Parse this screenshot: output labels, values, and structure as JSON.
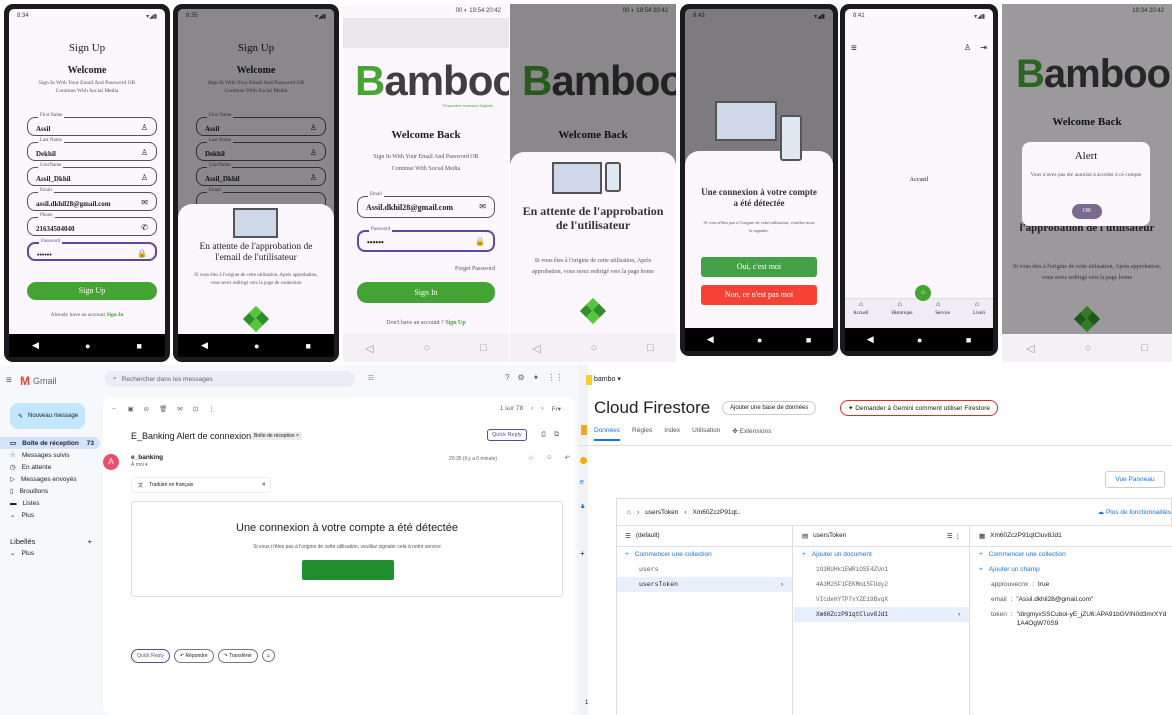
{
  "signup": {
    "time": "8:34",
    "title": "Sign Up",
    "welcome": "Welcome",
    "subtitle": "Sign In With Your Email And Password OR Continue With Social Media",
    "fields": [
      {
        "label": "First Name",
        "value": "Assil",
        "icon": "person-icon"
      },
      {
        "label": "Last Name",
        "value": "Dekhil",
        "icon": "person-icon"
      },
      {
        "label": "UserName",
        "value": "Assil_Dkhil",
        "icon": "person-icon"
      },
      {
        "label": "Email",
        "value": "assil.dkhil28@gmail.com",
        "icon": "mail-icon"
      },
      {
        "label": "Phone",
        "value": "21634504040",
        "icon": "phone-icon"
      },
      {
        "label": "Password",
        "value": "••••••",
        "icon": "lock-icon"
      }
    ],
    "button": "Sign Up",
    "footer_text": "Already have an account",
    "footer_link": "Sign In"
  },
  "signup_wait": {
    "time": "8:35",
    "title": "Sign Up",
    "welcome": "Welcome",
    "subtitle": "Sign In With Your Email And Password OR Continue With Social Media",
    "fields": [
      {
        "label": "First Name",
        "value": "Assil"
      },
      {
        "label": "Last Name",
        "value": "Dekhil"
      },
      {
        "label": "UserName",
        "value": "Assil_Dkhil"
      },
      {
        "label": "Email",
        "value": ""
      }
    ],
    "sheet_title": "En attente de l'approbation de l'email de l'utilisateur",
    "sheet_text": "Si vous êtes à l'origine de cette utilisation, Après approbation, vous serez redirigé vers la page de connexion"
  },
  "signin": {
    "status": "00 ◐ 19:54 20:42",
    "logo_a": "B",
    "logo_b": "amboo",
    "tagline": "Financière Inclusive Digitale",
    "welcome": "Welcome Back",
    "subtitle": "Sign In With Your Email And Password OR Continue With Social Media",
    "email_label": "Email",
    "email_value": "Assil.dkhil28@gmail.com",
    "password_label": "Password",
    "password_value": "••••••",
    "forget": "Forget Password",
    "button": "Sign In",
    "footer_text": "Don't have an account ?",
    "footer_link": "Sign Up"
  },
  "signin_wait": {
    "status": "00 ◐ 19:54 20:42",
    "logo_b": "amboo",
    "welcome": "Welcome Back",
    "sheet_title": "En attente de l'approbation de l'utilisateur",
    "sheet_text": "Si vous êtes à l'origine de cette utilisation, Après approbation, vous serez redirigé vers la page home"
  },
  "detect": {
    "time": "8:43",
    "title": "Une connexion à votre compte a été détectée",
    "text": "Si vous n'êtes pas à l'origine de cette utilisation, veuillez nous le signaler.",
    "yes": "Oui, c'est moi",
    "no": "Non, ce n'est pas moi"
  },
  "home": {
    "time": "8:41",
    "center": "Accueil",
    "tabs": [
      "Accueil",
      "Historique",
      "Service",
      "Lixeli"
    ]
  },
  "alert": {
    "status": "19:34 20:42",
    "logo_b": "amboo",
    "welcome": "Welcome Back",
    "title": "Alert",
    "message": "Vous n'avez pas été autorisé à accéder à ce compte",
    "ok": "OK",
    "bg_title": "l'approbation de l'utilisateur",
    "bg_text": "Si vous êtes à l'origine de cette utilisation, Après approbation, vous serez redirigé vers la page home"
  },
  "gmail": {
    "app": "Gmail",
    "search": "Rechercher dans les messages",
    "compose": "Nouveau message",
    "nav": [
      {
        "icon": "inbox-icon",
        "label": "Boîte de réception",
        "count": "73"
      },
      {
        "icon": "star-icon",
        "label": "Messages suivis",
        "count": ""
      },
      {
        "icon": "clock-icon",
        "label": "En attente",
        "count": ""
      },
      {
        "icon": "send-icon",
        "label": "Messages envoyés",
        "count": ""
      },
      {
        "icon": "file-icon",
        "label": "Brouillons",
        "count": ""
      },
      {
        "icon": "list-icon",
        "label": "Listes",
        "count": ""
      },
      {
        "icon": "chevron-down-icon",
        "label": "Plus",
        "count": ""
      }
    ],
    "labels_title": "Libellés",
    "labels_more": "Plus",
    "pager": "1 sur 78",
    "subject": "E_Banking Alert de connexion",
    "inbox_tag": "Boîte de réception ×",
    "quick_reply": "Quick Reply",
    "sender": "e_banking",
    "to": "À moi ▾",
    "date": "20:35 (il y a 0 minute)",
    "translate": "Traduire en français",
    "mail_title": "Une connexion à votre compte a été détectée",
    "mail_text": "Si vous n'êtes pas à l'origine de cette utilisation, veuillez signaler cela à notre service",
    "reply": "Répondre",
    "forward": "Transférer"
  },
  "firestore": {
    "project": "bambo",
    "title": "Cloud Firestore",
    "add_db": "Ajouter une base de données",
    "gemini": "Demander à Gemini comment utiliser Firestore",
    "tabs": [
      "Données",
      "Règles",
      "Index",
      "Utilisation",
      "Extensions"
    ],
    "panel_view": "Vue Panneau",
    "breadcrumb": [
      "usersToken",
      "Xm60ZczP91qt.."
    ],
    "more": "Plus de fonctionnalités",
    "col1_title": "(default)",
    "col1_action": "Commencer une collection",
    "col1_items": [
      "users",
      "usersToken"
    ],
    "col2_title": "usersToken",
    "col2_action": "Ajouter un document",
    "col2_items": [
      "1O3RUHk1EWRiOSE4ZUo1",
      "4A3M2SF1FEKMm15FUdy2",
      "VIcdeHYTP7xYZE19BvqX",
      "Xm60ZczP91qtCluv8Jd1"
    ],
    "col3_title": "Xm60ZczP91qtCluv8Jd1",
    "col3_action1": "Commencer une collection",
    "col3_action2": "Ajouter un champ",
    "fields": [
      {
        "key": "approuvecnx",
        "value": "true"
      },
      {
        "key": "email",
        "value": "\"Assil.dkhil28@gmail.com\""
      },
      {
        "key": "token",
        "value": "\"dirgmyxSSCuboi-yE_jZU6:APA91bGVIN0d3mrXYd1A4OgW70S9"
      }
    ]
  }
}
